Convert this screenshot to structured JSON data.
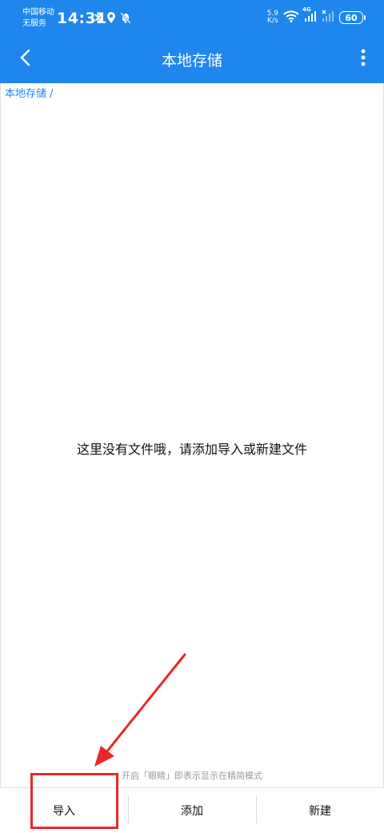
{
  "status_bar": {
    "carrier_line1": "中国移动",
    "carrier_line2": "无服务",
    "time": "14:31",
    "speed_value": "5.9",
    "speed_unit": "K/s",
    "network": "4G",
    "battery": "60",
    "icons": [
      "bluetooth-icon",
      "location-icon",
      "mute-bell-icon",
      "wifi-icon",
      "signal-icon",
      "signal-off-icon",
      "battery-icon"
    ]
  },
  "app_bar": {
    "title": "本地存储",
    "back_icon": "back-arrow-icon",
    "menu_icon": "more-vertical-icon"
  },
  "breadcrumb": "本地存储 /",
  "empty_message": "这里没有文件哦，请添加导入或新建文件",
  "hint": "开启「眼睛」即表示显示在精简模式",
  "bottom_bar": {
    "tabs": [
      {
        "label": "导入"
      },
      {
        "label": "添加"
      },
      {
        "label": "新建"
      }
    ]
  },
  "annotation": {
    "color": "#e82828"
  },
  "colors": {
    "primary": "#1e86ec",
    "background": "#ffffff",
    "text": "#111111",
    "hint": "#9a9a9a"
  }
}
